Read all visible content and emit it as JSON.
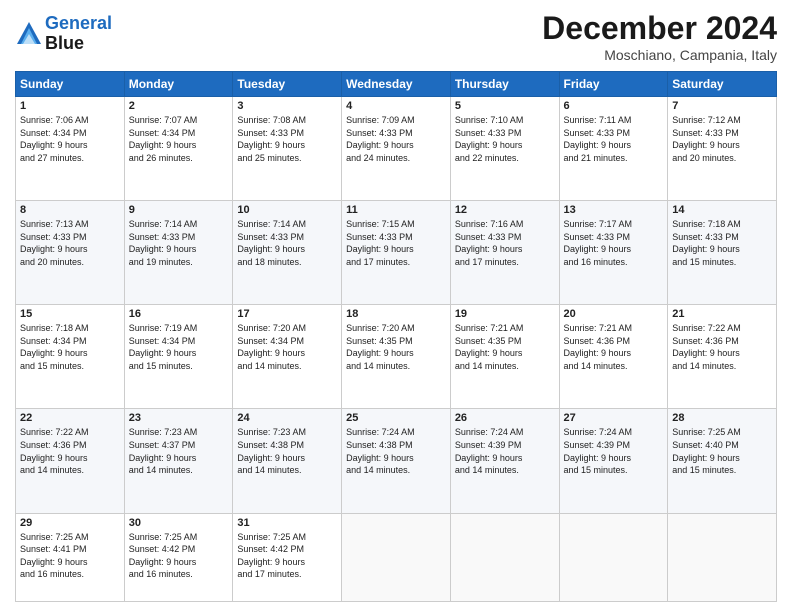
{
  "header": {
    "logo_line1": "General",
    "logo_line2": "Blue",
    "month_title": "December 2024",
    "location": "Moschiano, Campania, Italy"
  },
  "weekdays": [
    "Sunday",
    "Monday",
    "Tuesday",
    "Wednesday",
    "Thursday",
    "Friday",
    "Saturday"
  ],
  "weeks": [
    [
      {
        "day": "1",
        "info": "Sunrise: 7:06 AM\nSunset: 4:34 PM\nDaylight: 9 hours\nand 27 minutes."
      },
      {
        "day": "2",
        "info": "Sunrise: 7:07 AM\nSunset: 4:34 PM\nDaylight: 9 hours\nand 26 minutes."
      },
      {
        "day": "3",
        "info": "Sunrise: 7:08 AM\nSunset: 4:33 PM\nDaylight: 9 hours\nand 25 minutes."
      },
      {
        "day": "4",
        "info": "Sunrise: 7:09 AM\nSunset: 4:33 PM\nDaylight: 9 hours\nand 24 minutes."
      },
      {
        "day": "5",
        "info": "Sunrise: 7:10 AM\nSunset: 4:33 PM\nDaylight: 9 hours\nand 22 minutes."
      },
      {
        "day": "6",
        "info": "Sunrise: 7:11 AM\nSunset: 4:33 PM\nDaylight: 9 hours\nand 21 minutes."
      },
      {
        "day": "7",
        "info": "Sunrise: 7:12 AM\nSunset: 4:33 PM\nDaylight: 9 hours\nand 20 minutes."
      }
    ],
    [
      {
        "day": "8",
        "info": "Sunrise: 7:13 AM\nSunset: 4:33 PM\nDaylight: 9 hours\nand 20 minutes."
      },
      {
        "day": "9",
        "info": "Sunrise: 7:14 AM\nSunset: 4:33 PM\nDaylight: 9 hours\nand 19 minutes."
      },
      {
        "day": "10",
        "info": "Sunrise: 7:14 AM\nSunset: 4:33 PM\nDaylight: 9 hours\nand 18 minutes."
      },
      {
        "day": "11",
        "info": "Sunrise: 7:15 AM\nSunset: 4:33 PM\nDaylight: 9 hours\nand 17 minutes."
      },
      {
        "day": "12",
        "info": "Sunrise: 7:16 AM\nSunset: 4:33 PM\nDaylight: 9 hours\nand 17 minutes."
      },
      {
        "day": "13",
        "info": "Sunrise: 7:17 AM\nSunset: 4:33 PM\nDaylight: 9 hours\nand 16 minutes."
      },
      {
        "day": "14",
        "info": "Sunrise: 7:18 AM\nSunset: 4:33 PM\nDaylight: 9 hours\nand 15 minutes."
      }
    ],
    [
      {
        "day": "15",
        "info": "Sunrise: 7:18 AM\nSunset: 4:34 PM\nDaylight: 9 hours\nand 15 minutes."
      },
      {
        "day": "16",
        "info": "Sunrise: 7:19 AM\nSunset: 4:34 PM\nDaylight: 9 hours\nand 15 minutes."
      },
      {
        "day": "17",
        "info": "Sunrise: 7:20 AM\nSunset: 4:34 PM\nDaylight: 9 hours\nand 14 minutes."
      },
      {
        "day": "18",
        "info": "Sunrise: 7:20 AM\nSunset: 4:35 PM\nDaylight: 9 hours\nand 14 minutes."
      },
      {
        "day": "19",
        "info": "Sunrise: 7:21 AM\nSunset: 4:35 PM\nDaylight: 9 hours\nand 14 minutes."
      },
      {
        "day": "20",
        "info": "Sunrise: 7:21 AM\nSunset: 4:36 PM\nDaylight: 9 hours\nand 14 minutes."
      },
      {
        "day": "21",
        "info": "Sunrise: 7:22 AM\nSunset: 4:36 PM\nDaylight: 9 hours\nand 14 minutes."
      }
    ],
    [
      {
        "day": "22",
        "info": "Sunrise: 7:22 AM\nSunset: 4:36 PM\nDaylight: 9 hours\nand 14 minutes."
      },
      {
        "day": "23",
        "info": "Sunrise: 7:23 AM\nSunset: 4:37 PM\nDaylight: 9 hours\nand 14 minutes."
      },
      {
        "day": "24",
        "info": "Sunrise: 7:23 AM\nSunset: 4:38 PM\nDaylight: 9 hours\nand 14 minutes."
      },
      {
        "day": "25",
        "info": "Sunrise: 7:24 AM\nSunset: 4:38 PM\nDaylight: 9 hours\nand 14 minutes."
      },
      {
        "day": "26",
        "info": "Sunrise: 7:24 AM\nSunset: 4:39 PM\nDaylight: 9 hours\nand 14 minutes."
      },
      {
        "day": "27",
        "info": "Sunrise: 7:24 AM\nSunset: 4:39 PM\nDaylight: 9 hours\nand 15 minutes."
      },
      {
        "day": "28",
        "info": "Sunrise: 7:25 AM\nSunset: 4:40 PM\nDaylight: 9 hours\nand 15 minutes."
      }
    ],
    [
      {
        "day": "29",
        "info": "Sunrise: 7:25 AM\nSunset: 4:41 PM\nDaylight: 9 hours\nand 16 minutes."
      },
      {
        "day": "30",
        "info": "Sunrise: 7:25 AM\nSunset: 4:42 PM\nDaylight: 9 hours\nand 16 minutes."
      },
      {
        "day": "31",
        "info": "Sunrise: 7:25 AM\nSunset: 4:42 PM\nDaylight: 9 hours\nand 17 minutes."
      },
      null,
      null,
      null,
      null
    ]
  ]
}
